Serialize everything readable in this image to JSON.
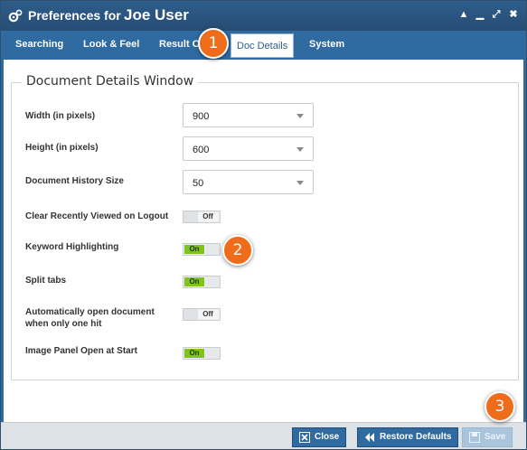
{
  "window": {
    "title": "Preferences for",
    "user": "Joe User"
  },
  "tabs": [
    {
      "label": "Searching"
    },
    {
      "label": "Look & Feel"
    },
    {
      "label": "Result C"
    },
    {
      "label": "Doc Details",
      "active": true
    },
    {
      "label": "System"
    }
  ],
  "section": {
    "legend": "Document Details Window"
  },
  "settings": {
    "width": {
      "label": "Width (in pixels)",
      "value": "900"
    },
    "height": {
      "label": "Height (in pixels)",
      "value": "600"
    },
    "history": {
      "label": "Document History Size",
      "value": "50"
    },
    "clear_recent": {
      "label": "Clear Recently Viewed on Logout",
      "state": "Off"
    },
    "keyword": {
      "label": "Keyword Highlighting",
      "state": "On"
    },
    "split": {
      "label": "Split tabs",
      "state": "On"
    },
    "auto_open": {
      "label_line1": "Automatically open document",
      "label_line2": "when only one hit",
      "state": "Off"
    },
    "image_panel": {
      "label": "Image Panel Open at Start",
      "state": "On"
    }
  },
  "footer": {
    "close": "Close",
    "restore": "Restore Defaults",
    "save": "Save"
  },
  "callouts": [
    "1",
    "2",
    "3"
  ],
  "colors": {
    "accent": "#2f6aa0",
    "toggle_on": "#7fc31c",
    "callout": "#ef6c1a"
  }
}
